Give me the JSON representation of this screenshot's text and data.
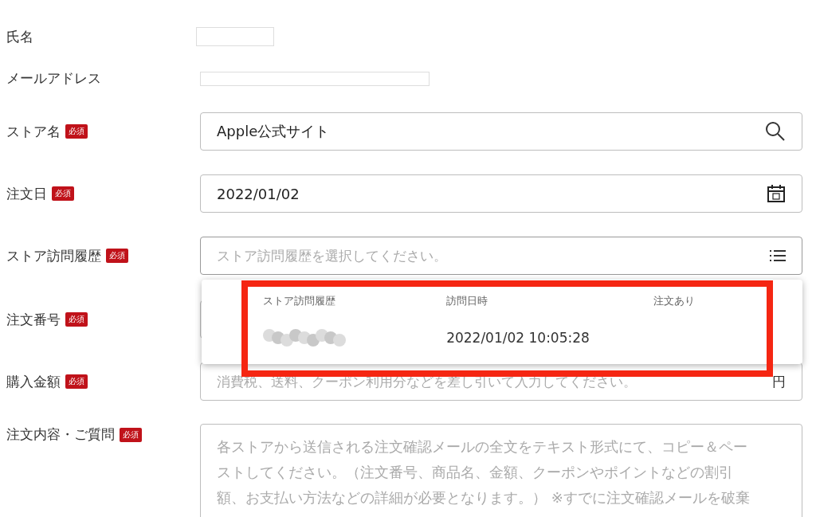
{
  "fields": [
    {
      "label": "氏名",
      "kind": "blank"
    },
    {
      "label": "メールアドレス",
      "kind": "redacted"
    },
    {
      "label": "ストア名",
      "badge": "必須",
      "kind": "search",
      "value": "Apple公式サイト"
    },
    {
      "label": "注文日",
      "badge": "必須",
      "kind": "date",
      "value": "2022/01/02"
    },
    {
      "label": "ストア訪問履歴",
      "badge": "必須",
      "kind": "select",
      "placeholder": "ストア訪問履歴を選択してください。",
      "expanded": true
    },
    {
      "label": "注文番号",
      "badge": "必須",
      "kind": "text"
    },
    {
      "label": "購入金額",
      "badge": "必須",
      "kind": "amount",
      "placeholder": "消費税、送料、クーポン利用分などを差し引いて入力してください。",
      "suffix": "円"
    },
    {
      "label": "注文内容・ご質問",
      "badge": "必須",
      "kind": "textarea",
      "placeholder": "各ストアから送信される注文確認メールの全文をテキスト形式にて、コピー＆ペーストしてください。（注文番号、商品名、金額、クーポンやポイントなどの割引額、お支払い方法などの詳細が必要となります。） ※すでに注文確認メールを破棄"
    }
  ],
  "dropdown": {
    "columns": [
      "ストア訪問履歴",
      "訪問日時",
      "注文あり"
    ],
    "rows": [
      {
        "visit_time": "2022/01/02 10:05:28"
      }
    ]
  }
}
